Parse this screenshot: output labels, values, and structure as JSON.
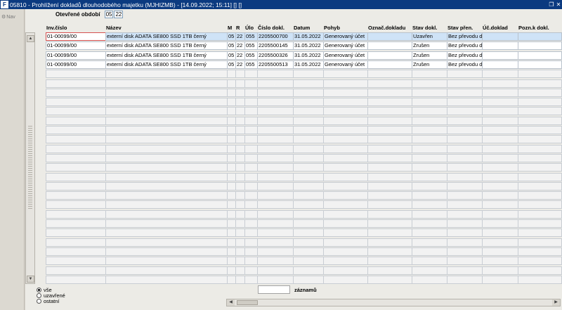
{
  "window": {
    "title": "05810 - Prohlížení dokladů dlouhodobého majetku (MJHIZMB) - [14.09.2022; 15:11] [] []",
    "app_icon": "F",
    "restore_icon": "❐",
    "close_icon": "✕"
  },
  "side": {
    "nav_label": "Nav",
    "nav_icon": "⚙"
  },
  "period": {
    "label": "Otevřené období",
    "month": "05",
    "year": "22"
  },
  "columns": [
    "Inv.číslo",
    "Název",
    "M",
    "R",
    "Úlo",
    "Číslo dokl.",
    "Datum",
    "Pohyb",
    "Označ.dokladu",
    "Stav dokl.",
    "Stav přen.",
    "Úč.doklad",
    "Pozn.k dokl."
  ],
  "rows": [
    [
      "01-00099/00",
      "externí disk ADATA SE800 SSD 1TB černý",
      "05",
      "22",
      "055",
      "2205500700",
      "31.05.2022",
      "Generovaný účet",
      "",
      "Uzavřen",
      "Bez převodu do",
      "",
      ""
    ],
    [
      "01-00099/00",
      "externí disk ADATA SE800 SSD 1TB černý",
      "05",
      "22",
      "055",
      "2205500145",
      "31.05.2022",
      "Generovaný účet",
      "",
      "Zrušen",
      "Bez převodu do",
      "",
      ""
    ],
    [
      "01-00099/00",
      "externí disk ADATA SE800 SSD 1TB černý",
      "05",
      "22",
      "055",
      "2205500326",
      "31.05.2022",
      "Generovaný účet",
      "",
      "Zrušen",
      "Bez převodu do",
      "",
      ""
    ],
    [
      "01-00099/00",
      "externí disk ADATA SE800 SSD 1TB černý",
      "05",
      "22",
      "055",
      "2205500513",
      "31.05.2022",
      "Generovaný účet",
      "",
      "Zrušen",
      "Bez převodu do",
      "",
      ""
    ]
  ],
  "filters": [
    {
      "label": "vše",
      "selected": true
    },
    {
      "label": "uzavřené",
      "selected": false
    },
    {
      "label": "ostatní",
      "selected": false
    }
  ],
  "records": {
    "label": "záznamů",
    "value": ""
  },
  "scroll": {
    "up": "▲",
    "down": "▼",
    "left": "◀",
    "right": "▶"
  }
}
